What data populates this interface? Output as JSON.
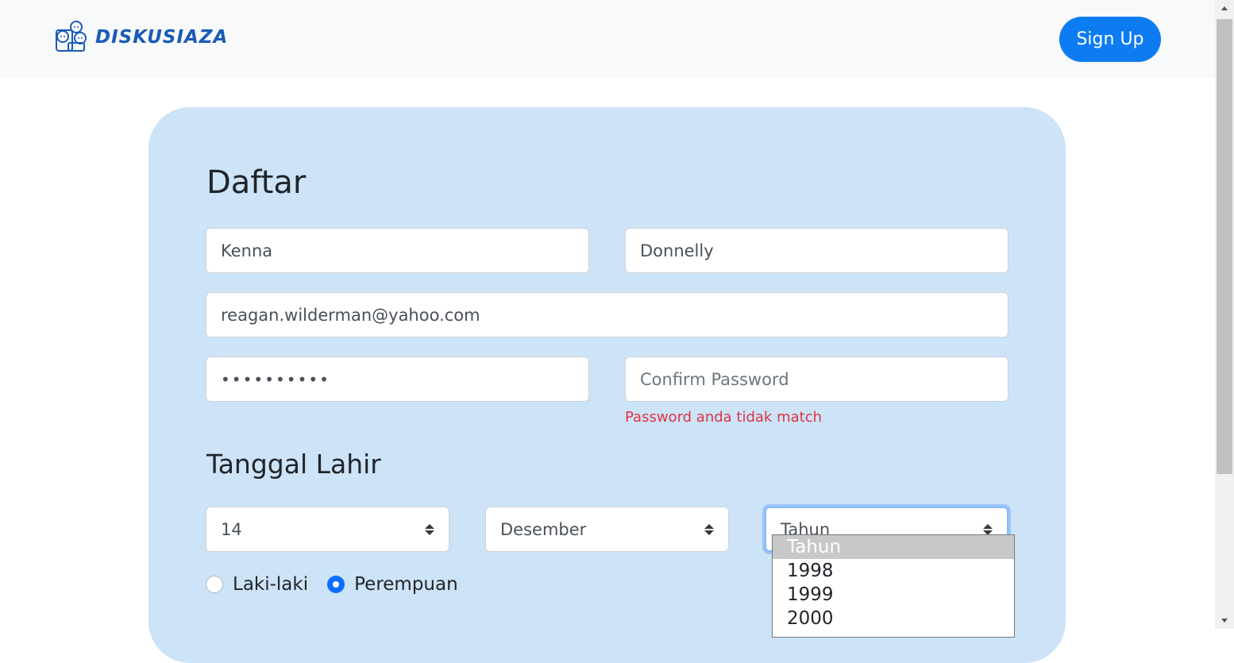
{
  "header": {
    "logo_text": "DISKUSIAZA",
    "signup_label": "Sign Up"
  },
  "form": {
    "title": "Daftar",
    "first_name": "Kenna",
    "last_name": "Donnelly",
    "email": "reagan.wilderman@yahoo.com",
    "password_masked": "••••••••••",
    "confirm_password_placeholder": "Confirm Password",
    "error_text": "Password anda tidak match",
    "birth_title": "Tanggal Lahir",
    "day": "14",
    "month": "Desember",
    "year": "Tahun",
    "gender_options": [
      "Laki-laki",
      "Perempuan"
    ],
    "gender_selected": "Perempuan"
  },
  "year_dropdown": {
    "options": [
      "Tahun",
      "1998",
      "1999",
      "2000"
    ],
    "highlighted": "Tahun"
  },
  "colors": {
    "brand": "#1a5bb8",
    "button": "#0d7cf2",
    "card_bg": "#cde3f7",
    "error": "#dc3545",
    "radio_checked": "#0d6efd"
  }
}
